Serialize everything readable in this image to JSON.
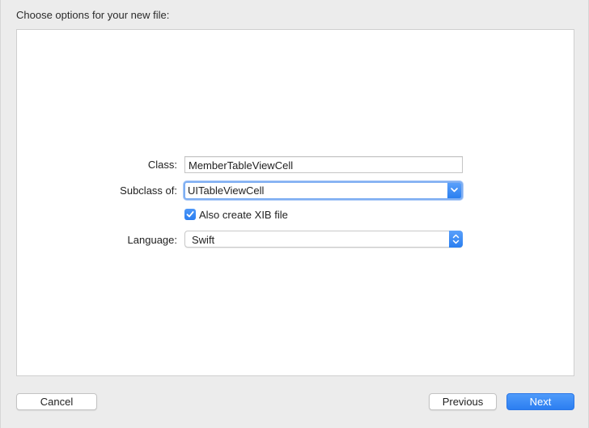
{
  "heading": "Choose options for your new file:",
  "form": {
    "class_label": "Class:",
    "class_value": "MemberTableViewCell",
    "subclass_label": "Subclass of:",
    "subclass_value": "UITableViewCell",
    "xib_label": "Also create XIB file",
    "xib_checked": true,
    "language_label": "Language:",
    "language_value": "Swift"
  },
  "buttons": {
    "cancel": "Cancel",
    "previous": "Previous",
    "next": "Next"
  },
  "colors": {
    "accent": "#2b7ef1",
    "background": "#ececec",
    "panel": "#ffffff"
  },
  "icons": {
    "combo_arrow": "chevron-down-icon",
    "popup_arrow": "up-down-chevron-icon",
    "checkbox": "checkmark-icon"
  }
}
